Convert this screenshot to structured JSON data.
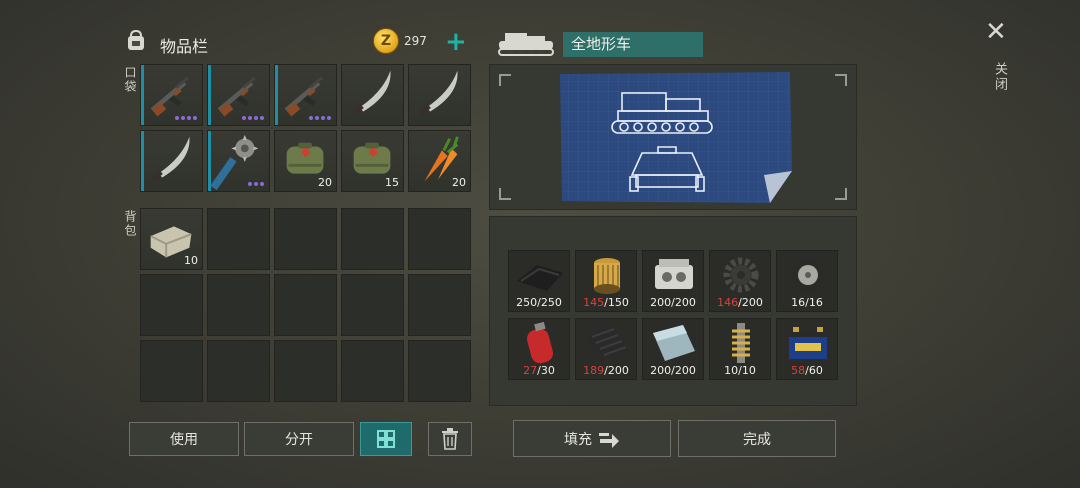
{
  "inventory": {
    "title": "物品栏",
    "coins": "297",
    "coin_symbol": "Z",
    "plus_label": "+",
    "pocket_label": "口袋",
    "backpack_label": "背包",
    "pocket_slots": [
      {
        "icon": "ak-rifle-icon",
        "qty": "",
        "dots": 4
      },
      {
        "icon": "ak-rifle-icon",
        "qty": "",
        "dots": 4
      },
      {
        "icon": "ak-rifle-icon",
        "qty": "",
        "dots": 4
      },
      {
        "icon": "machete-icon",
        "qty": "",
        "dots": 0
      },
      {
        "icon": "machete-icon",
        "qty": "",
        "dots": 0
      },
      {
        "icon": "machete-icon",
        "qty": "",
        "dots": 0
      },
      {
        "icon": "spiked-club-icon",
        "qty": "",
        "dots": 3
      },
      {
        "icon": "medkit-bag-icon",
        "qty": "20",
        "dots": 0
      },
      {
        "icon": "medkit-bag-icon",
        "qty": "15",
        "dots": 0
      },
      {
        "icon": "carrot-icon",
        "qty": "20",
        "dots": 0
      }
    ],
    "backpack_slots": [
      {
        "icon": "stone-block-icon",
        "qty": "10"
      }
    ]
  },
  "buttons": {
    "use": "使用",
    "split": "分开",
    "fill": "填充",
    "complete": "完成",
    "close": "关闭",
    "close_glyph": "✕"
  },
  "vehicle": {
    "name": "全地形车"
  },
  "materials": [
    {
      "icon": "leather-icon",
      "have": "250",
      "need": "/250",
      "low": false
    },
    {
      "icon": "oil-filter-icon",
      "have": "145",
      "need": "/150",
      "low": true
    },
    {
      "icon": "engine-block-icon",
      "have": "200",
      "need": "/200",
      "low": false
    },
    {
      "icon": "gear-icon",
      "have": "146",
      "need": "/200",
      "low": true
    },
    {
      "icon": "wheel-icon",
      "have": "16",
      "need": "/16",
      "low": false
    },
    {
      "icon": "gas-cylinder-icon",
      "have": "27",
      "need": "/30",
      "low": true
    },
    {
      "icon": "rubber-sheet-icon",
      "have": "189",
      "need": "/200",
      "low": true
    },
    {
      "icon": "steel-plate-icon",
      "have": "200",
      "need": "/200",
      "low": false
    },
    {
      "icon": "spring-shock-icon",
      "have": "10",
      "need": "/10",
      "low": false
    },
    {
      "icon": "car-battery-icon",
      "have": "58",
      "need": "/60",
      "low": true
    }
  ]
}
